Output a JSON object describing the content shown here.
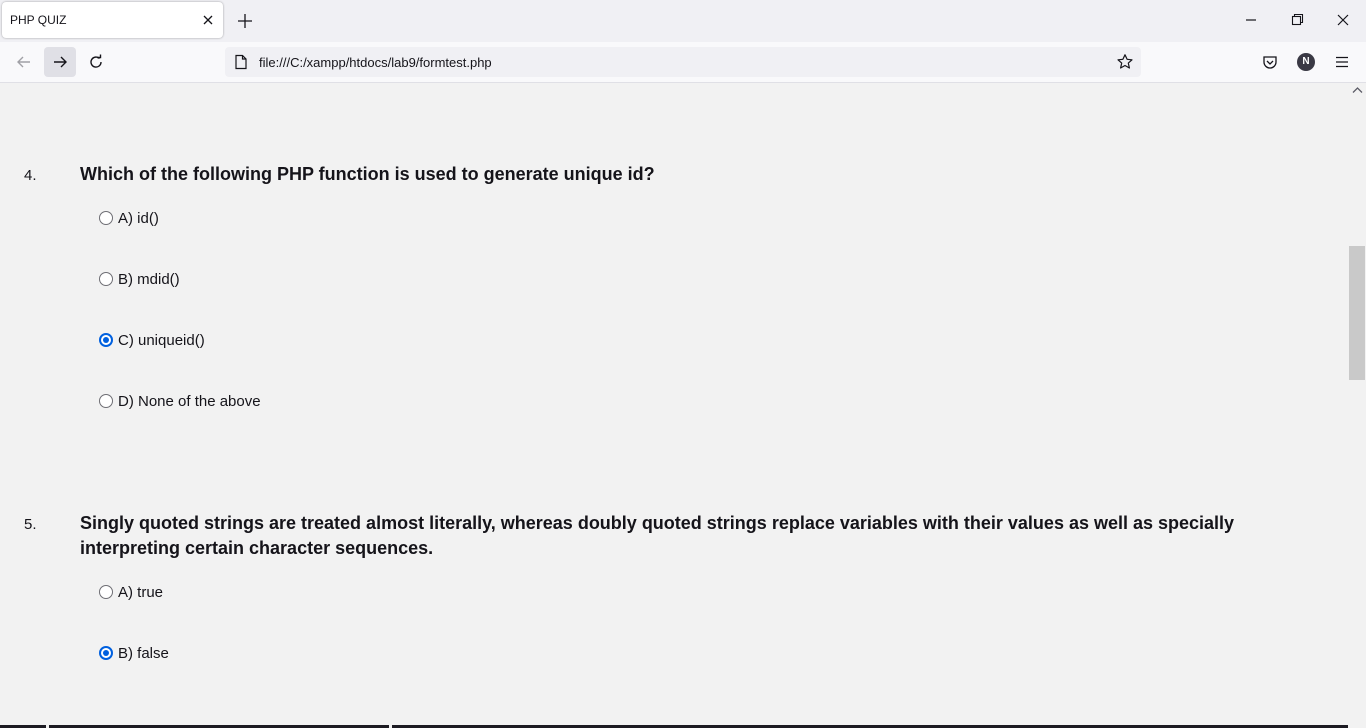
{
  "browser": {
    "tab": {
      "title": "PHP QUIZ"
    },
    "url": "file:///C:/xampp/htdocs/lab9/formtest.php",
    "avatar_letter": "N"
  },
  "questions": [
    {
      "number": "4.",
      "text": "Which of the following PHP function is used to generate unique id?",
      "options": [
        {
          "label": "A) id()",
          "checked": false
        },
        {
          "label": "B) mdid()",
          "checked": false
        },
        {
          "label": "C) uniqueid()",
          "checked": true
        },
        {
          "label": "D) None of the above",
          "checked": false
        }
      ]
    },
    {
      "number": "5.",
      "text": "Singly quoted strings are treated almost literally, whereas doubly quoted strings replace variables with their values as well as specially interpreting certain character sequences.",
      "options": [
        {
          "label": "A) true",
          "checked": false
        },
        {
          "label": "B) false",
          "checked": true
        }
      ]
    }
  ],
  "colors": {
    "accent": "#0060df",
    "page_bg": "#f2f2f2",
    "text": "#15141a"
  }
}
